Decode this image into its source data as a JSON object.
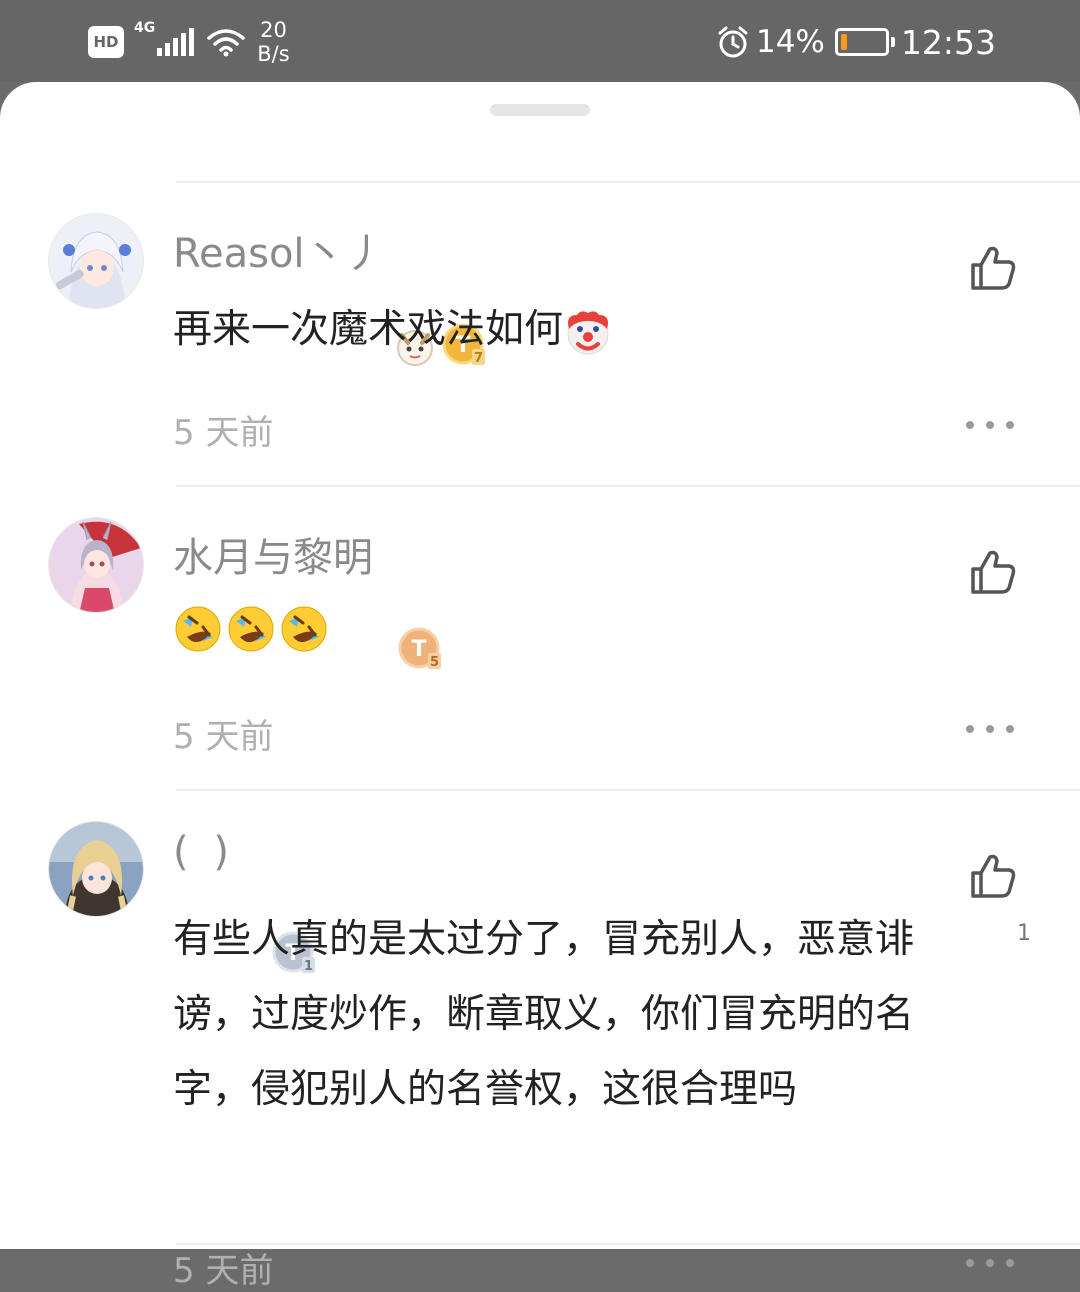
{
  "status_bar": {
    "hd": "HD",
    "network_type": "4G",
    "net_speed_value": "20",
    "net_speed_unit": "B/s",
    "battery_percent": "14%",
    "battery_level": 0.14,
    "time": "12:53"
  },
  "comments": [
    {
      "username": "Reasol丶丿",
      "text": "再来一次魔术戏法如何",
      "emoji": "clown-face",
      "time": "5 天前",
      "level_badge": "T7",
      "like_count": ""
    },
    {
      "username": "水月与黎明",
      "text": "",
      "emoji": "rolling-on-floor-laughing x3",
      "time": "5 天前",
      "level_badge": "T5",
      "like_count": ""
    },
    {
      "username": "( )",
      "text": "有些人真的是太过分了，冒充别人，恶意诽谤，过度炒作，断章取义，你们冒充明的名字，侵犯别人的名誉权，这很合理吗",
      "emoji": "",
      "time": "5 天前",
      "level_badge": "T1",
      "like_count": "1"
    }
  ],
  "colors": {
    "username": "#8a8a8a",
    "body_text": "#222222",
    "timestamp": "#b0b0b0",
    "status_bar_bg": "#666666",
    "battery_fill": "#ff9a1f"
  }
}
